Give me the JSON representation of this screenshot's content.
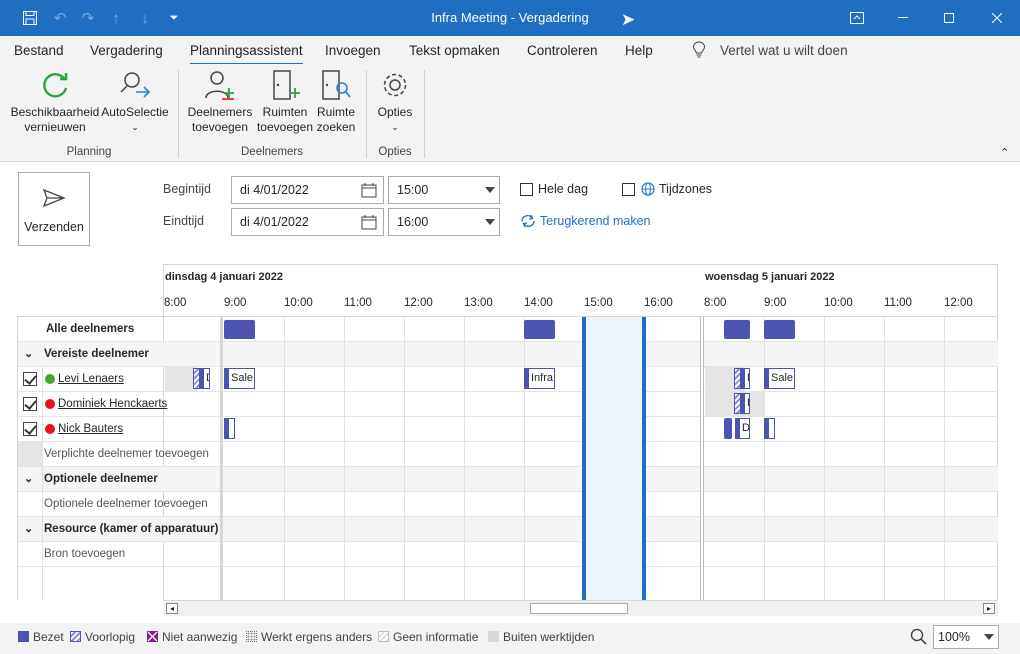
{
  "window": {
    "title": "Infra Meeting  -  Vergadering"
  },
  "menu": [
    {
      "label": "Bestand"
    },
    {
      "label": "Vergadering"
    },
    {
      "label": "Planningsassistent"
    },
    {
      "label": "Invoegen"
    },
    {
      "label": "Tekst opmaken"
    },
    {
      "label": "Controleren"
    },
    {
      "label": "Help"
    }
  ],
  "tell_me": "Vertel wat u wilt doen",
  "ribbon": {
    "refresh": [
      "Beschikbaarheid",
      "vernieuwen"
    ],
    "autoselect": "AutoSelectie",
    "group_planning": "Planning",
    "add_attendees": [
      "Deelnemers",
      "toevoegen"
    ],
    "add_rooms": [
      "Ruimten",
      "toevoegen"
    ],
    "find_rooms": [
      "Ruimte",
      "zoeken"
    ],
    "group_attendees": "Deelnemers",
    "options": "Opties",
    "group_options": "Opties"
  },
  "form": {
    "send": "Verzenden",
    "start_label": "Begintijd",
    "end_label": "Eindtijd",
    "start_date": "di 4/01/2022",
    "start_time": "15:00",
    "end_date": "di 4/01/2022",
    "end_time": "16:00",
    "all_day": "Hele dag",
    "time_zones": "Tijdzones",
    "recurring": "Terugkerend maken"
  },
  "grid": {
    "day1": "dinsdag 4 januari 2022",
    "day2": "woensdag 5 januari 2022",
    "hours1": [
      "8:00",
      "9:00",
      "10:00",
      "11:00",
      "12:00",
      "13:00",
      "14:00",
      "15:00",
      "16:00"
    ],
    "hours2": [
      "8:00",
      "9:00",
      "10:00",
      "11:00",
      "12:00"
    ],
    "all_attendees": "Alle deelnemers",
    "required_header": "Vereiste deelnemer",
    "attendees": [
      {
        "name": "Levi Lenaers",
        "status_color": "#3fa832"
      },
      {
        "name": "Dominiek Henckaerts",
        "status_color": "#e81123"
      },
      {
        "name": "Nick Bauters",
        "status_color": "#e81123"
      }
    ],
    "add_required": "Verplichte deelnemer toevoegen",
    "optional_header": "Optionele deelnemer",
    "add_optional": "Optionele deelnemer toevoegen",
    "resource_header": "Resource (kamer of apparatuur)",
    "add_resource": "Bron toevoegen",
    "appt_sale": "Sale",
    "appt_infra": "Infra",
    "appt_d": "D"
  },
  "legend": {
    "busy": "Bezet",
    "tentative": "Voorlopig",
    "oof": "Niet aanwezig",
    "elsewhere": "Werkt ergens anders",
    "no_info": "Geen informatie",
    "outside": "Buiten werktijden"
  },
  "zoom": "100%",
  "colors": {
    "accent": "#1f6ec2",
    "busy": "#4c53b0"
  }
}
